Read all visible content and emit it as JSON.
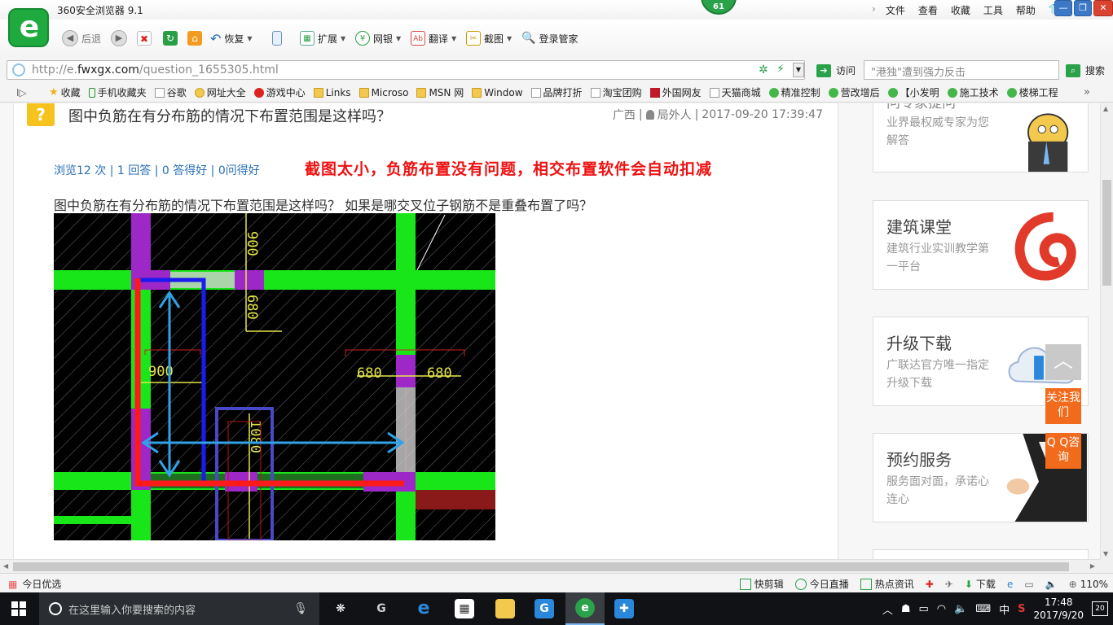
{
  "browser": {
    "title": "360安全浏览器 9.1",
    "counter": "61",
    "menus": [
      "文件",
      "查看",
      "收藏",
      "工具",
      "帮助"
    ],
    "win_min": "—",
    "win_max": "❐",
    "win_close": "✕"
  },
  "toolbar": {
    "back": "后退",
    "restore": "恢复",
    "extend": "扩展",
    "netbank": "网银",
    "translate": "翻译",
    "screenshot": "截图",
    "login": "登录管家"
  },
  "address": {
    "url_prefix": "http://e.",
    "url_domain": "fwxgx.com",
    "url_path": "/question_1655305.html",
    "visit_label": "访问",
    "search_placeholder": "\"港独\"遭到强力反击",
    "search_label": "搜索"
  },
  "bookmarks": {
    "collect_label": "收藏",
    "items": [
      {
        "label": "手机收藏夹",
        "icon": "phone-icon"
      },
      {
        "label": "谷歌",
        "icon": "page-icon"
      },
      {
        "label": "网址大全",
        "icon": "green-circle-icon"
      },
      {
        "label": "游戏中心",
        "icon": "red-circle-icon"
      },
      {
        "label": "Links",
        "icon": "folder-icon"
      },
      {
        "label": "Microso",
        "icon": "folder-icon"
      },
      {
        "label": "MSN 网",
        "icon": "folder-icon"
      },
      {
        "label": "Window",
        "icon": "folder-icon"
      },
      {
        "label": "品牌打折",
        "icon": "page-icon"
      },
      {
        "label": "淘宝团购",
        "icon": "page-icon"
      },
      {
        "label": "外国网友",
        "icon": "red-square-icon"
      },
      {
        "label": "天猫商城",
        "icon": "page-icon"
      },
      {
        "label": "精准控制",
        "icon": "wechat-icon"
      },
      {
        "label": "营改增后",
        "icon": "wechat-icon"
      },
      {
        "label": "【小发明",
        "icon": "wechat-icon"
      },
      {
        "label": "施工技术",
        "icon": "wechat-icon"
      },
      {
        "label": "楼梯工程",
        "icon": "wechat-icon"
      }
    ],
    "more": "»"
  },
  "question": {
    "icon_char": "?",
    "title": "图中负筋在有分布筋的情况下布置范围是这样吗？",
    "region": "广西",
    "user": "局外人",
    "datetime": "2017-09-20 17:39:47",
    "stats": "浏览12 次 | 1 回答 | 0 答得好 | 0问得好",
    "answer": "截图太小，负筋布置没有问题，相交布置软件会自动扣减",
    "body": "图中负筋在有分布筋的情况下布置范围是这样吗？ 如果是哪交叉位子钢筋不是重叠布置了吗？",
    "cad_labels": [
      "900",
      "680",
      "900",
      "680",
      "680",
      "1080"
    ]
  },
  "sidebar": [
    {
      "title": "问专家提问",
      "desc": "业界最权威专家为您解答"
    },
    {
      "title": "建筑课堂",
      "desc": "建筑行业实训教学第一平台"
    },
    {
      "title": "升级下载",
      "desc": "广联达官方唯一指定升级下载"
    },
    {
      "title": "预约服务",
      "desc": "服务面对面，承诺心连心"
    }
  ],
  "float": {
    "top_icon": "︿",
    "follow": "关注我们",
    "qq": "Q Q咨询"
  },
  "status": {
    "today_pick": "今日优选",
    "items": [
      "快剪辑",
      "今日直播",
      "热点资讯",
      "下载"
    ],
    "zoom": "110%"
  },
  "taskbar": {
    "search_placeholder": "在这里输入你要搜索的内容",
    "ime": "中",
    "time": "17:48",
    "date": "2017/9/20",
    "notif_count": "20"
  }
}
